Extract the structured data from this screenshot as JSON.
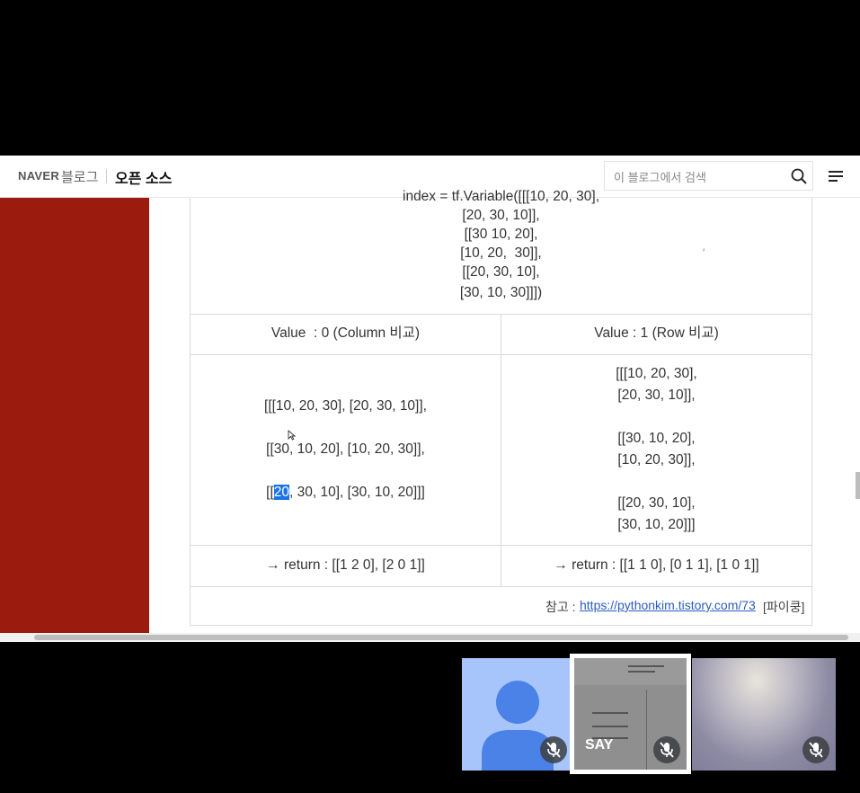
{
  "header": {
    "logo": "NAVER",
    "blog_label": "블로그",
    "blog_title": "오픈 소스",
    "search_placeholder": "이 블로그에서 검색"
  },
  "table": {
    "top_code_lines": [
      "index = tf.Variable([[[10, 20, 30],",
      "[20, 30, 10]],",
      "[[30 10, 20],",
      "[10, 20,  30]],",
      "[[20, 30, 10],",
      "[30, 10, 30]]])"
    ],
    "stray_mark": "′",
    "col1_header": "Value  : 0 (Column 비교)",
    "col2_header": "Value : 1 (Row 비교)",
    "col1_lines": [
      "[[[10, 20, 30], [20, 30, 10]],",
      "[[30, 10, 20], [10, 20, 30]],"
    ],
    "col1_line3_prefix": "[[",
    "col1_line3_highlight": "20",
    "col1_line3_suffix": ", 30, 10], [30, 10, 20]]]",
    "col2_lines": [
      "[[[10, 20, 30],",
      "[20, 30, 10]],",
      "[[30, 10, 20],",
      "[10, 20, 30]],",
      "[[20, 30, 10],",
      "[30, 10, 20]]]"
    ],
    "col1_return": "→ return : [[1 2 0], [2 0 1]]",
    "col2_return": "→ return : [[1 1 0], [0 1 1], [1 0 1]]",
    "ref_label": "참고 :",
    "ref_link": "https://pythonkim.tistory.com/73",
    "ref_tail": "[파이쿵]"
  },
  "meeting": {
    "tiles": [
      {
        "name": "",
        "muted": true,
        "kind": "avatar"
      },
      {
        "name": "SAY",
        "muted": true,
        "kind": "screen"
      },
      {
        "name": "",
        "muted": true,
        "kind": "camera"
      }
    ],
    "colors": {
      "avatar_bg": "#a8c5fb",
      "avatar_fg": "#4a82e8",
      "active_border": "#ffffff"
    }
  }
}
